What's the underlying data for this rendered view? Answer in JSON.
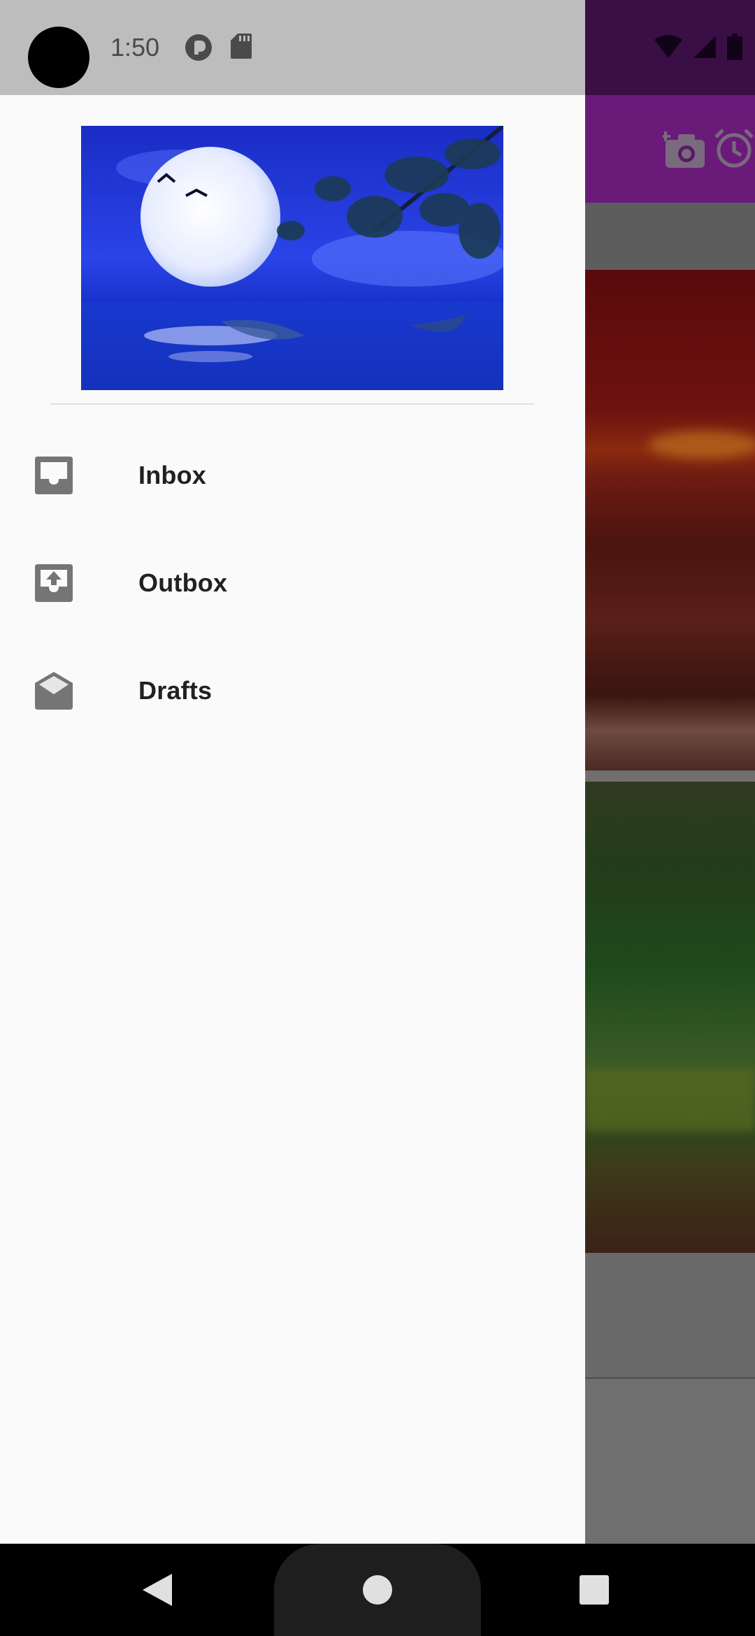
{
  "status_bar": {
    "time": "1:50",
    "icons": [
      "avatar-circle",
      "pocket-casts-icon",
      "sd-card-icon",
      "wifi-icon",
      "signal-icon",
      "battery-icon"
    ]
  },
  "background_app": {
    "toolbar_color": "#6a1b7a",
    "toolbar_icons": [
      "add-photo-icon",
      "alarm-icon"
    ]
  },
  "drawer": {
    "header_image": "night-moon-landscape",
    "items": [
      {
        "label": "Inbox",
        "icon": "inbox-icon"
      },
      {
        "label": "Outbox",
        "icon": "outbox-icon"
      },
      {
        "label": "Drafts",
        "icon": "drafts-icon"
      }
    ]
  },
  "nav_bar": {
    "buttons": [
      "back",
      "home",
      "recents"
    ]
  },
  "colors": {
    "drawer_bg": "#fafafa",
    "status_bar": "#bdbdbd",
    "icon_gray": "#757575",
    "text": "#212121"
  }
}
